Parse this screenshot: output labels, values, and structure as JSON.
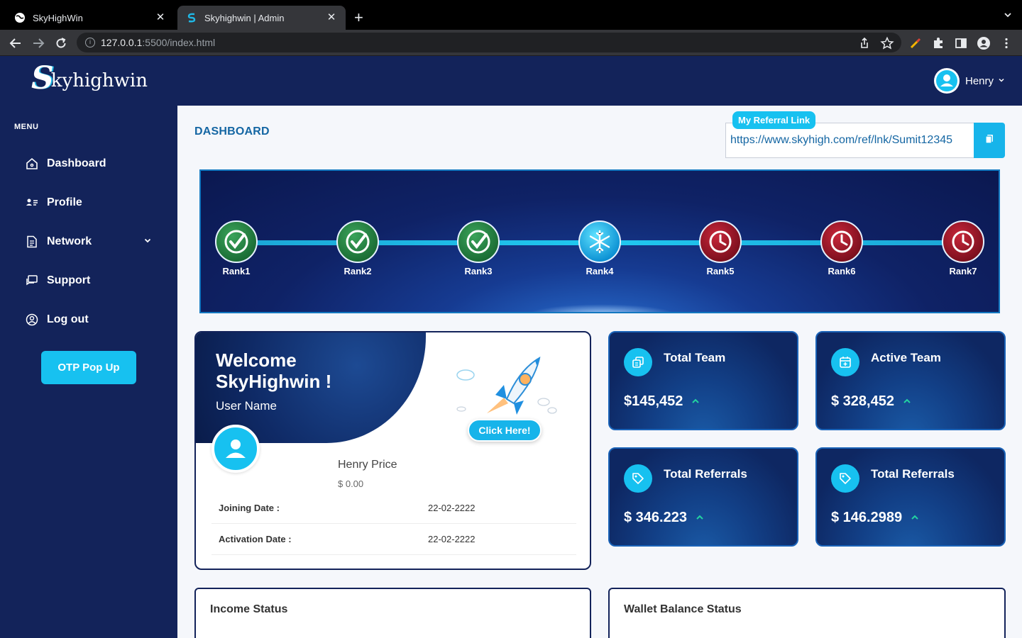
{
  "browser": {
    "tabs": [
      {
        "title": "SkyHighWin"
      },
      {
        "title": "Skyhighwin | Admin"
      }
    ],
    "url_host": "127.0.0.1",
    "url_path": ":5500/index.html"
  },
  "header": {
    "logo_initial": "S",
    "logo_rest": "kyhighwin",
    "user_name": "Henry"
  },
  "sidebar": {
    "menu_label": "MENU",
    "items": [
      {
        "label": "Dashboard",
        "icon": "home-icon"
      },
      {
        "label": "Profile",
        "icon": "profile-icon"
      },
      {
        "label": "Network",
        "icon": "document-icon"
      },
      {
        "label": "Support",
        "icon": "chat-icon"
      },
      {
        "label": "Log out",
        "icon": "user-circle-icon"
      }
    ],
    "otp_button": "OTP Pop Up"
  },
  "main": {
    "title": "DASHBOARD",
    "referral": {
      "badge": "My Referral Link",
      "link": "https://www.skyhigh.com/ref/lnk/Sumit12345"
    },
    "ranks": [
      {
        "label": "Rank1",
        "state": "done"
      },
      {
        "label": "Rank2",
        "state": "done"
      },
      {
        "label": "Rank3",
        "state": "done"
      },
      {
        "label": "Rank4",
        "state": "frozen"
      },
      {
        "label": "Rank5",
        "state": "locked"
      },
      {
        "label": "Rank6",
        "state": "locked"
      },
      {
        "label": "Rank7",
        "state": "locked"
      }
    ],
    "welcome": {
      "title_line1": "Welcome",
      "title_line2": "SkyHighwin !",
      "subtitle": "User Name",
      "click_button": "Click Here!",
      "name": "Henry Price",
      "balance": "$ 0.00",
      "rows": [
        {
          "key": "Joining Date :",
          "value": "22-02-2222"
        },
        {
          "key": "Activation Date :",
          "value": "22-02-2222"
        }
      ]
    },
    "stats": [
      {
        "title": "Total Team",
        "value": "$145,452"
      },
      {
        "title": "Active Team",
        "value": "$ 328,452"
      },
      {
        "title": "Total Referrals",
        "value": "$ 346.223"
      },
      {
        "title": "Total Referrals",
        "value": "$ 146.2989"
      }
    ],
    "panels": [
      {
        "title": "Income Status"
      },
      {
        "title": "Wallet Balance Status"
      }
    ]
  },
  "colors": {
    "navy": "#13235a",
    "accent": "#17c1f0",
    "title_blue": "#1466a3",
    "trend_green": "#22d3a0"
  }
}
